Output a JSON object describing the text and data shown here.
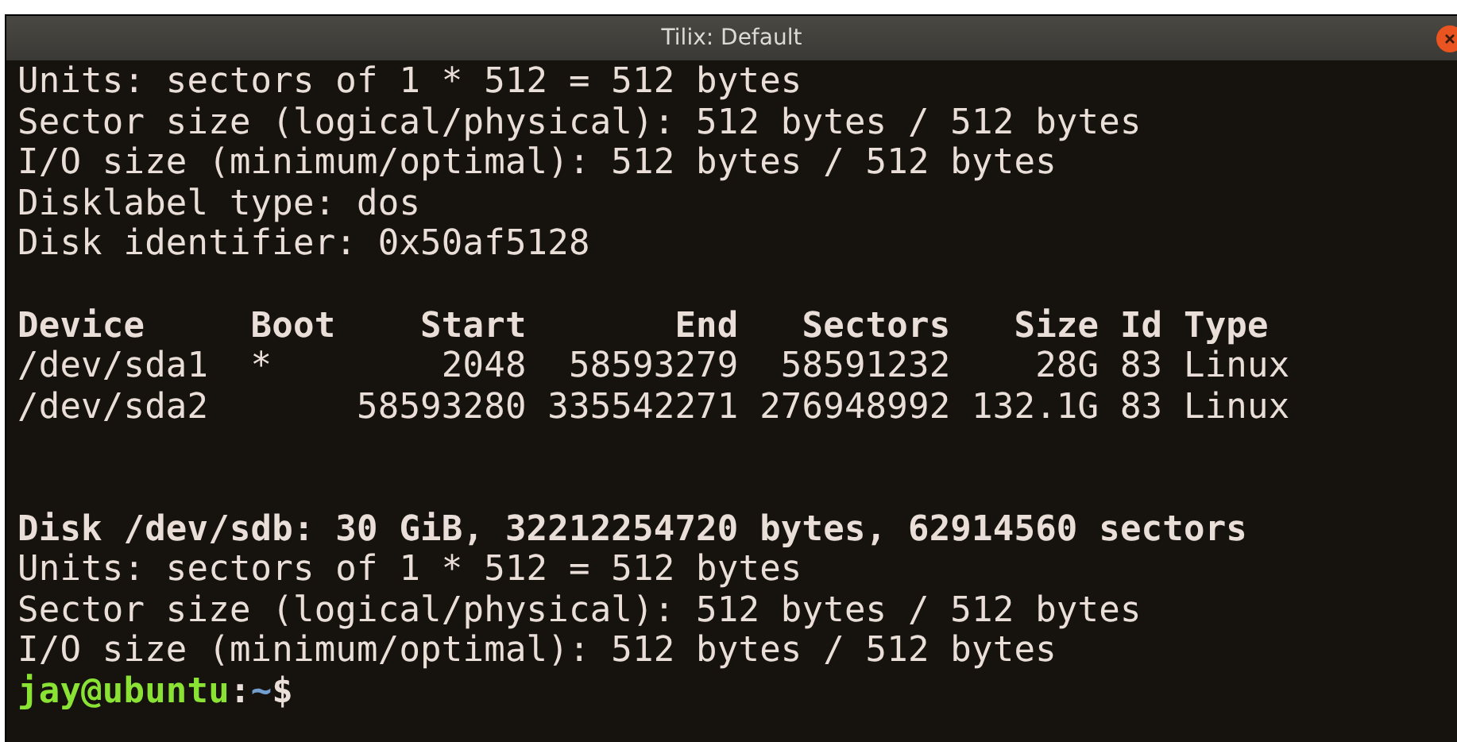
{
  "window": {
    "title": "Tilix: Default"
  },
  "terminal": {
    "lines": [
      {
        "kind": "normal",
        "text": "Units: sectors of 1 * 512 = 512 bytes"
      },
      {
        "kind": "normal",
        "text": "Sector size (logical/physical): 512 bytes / 512 bytes"
      },
      {
        "kind": "normal",
        "text": "I/O size (minimum/optimal): 512 bytes / 512 bytes"
      },
      {
        "kind": "normal",
        "text": "Disklabel type: dos"
      },
      {
        "kind": "normal",
        "text": "Disk identifier: 0x50af5128"
      },
      {
        "kind": "blank"
      },
      {
        "kind": "bold",
        "text": "Device     Boot    Start       End   Sectors   Size Id Type"
      },
      {
        "kind": "normal",
        "text": "/dev/sda1  *        2048  58593279  58591232    28G 83 Linux"
      },
      {
        "kind": "normal",
        "text": "/dev/sda2       58593280 335542271 276948992 132.1G 83 Linux"
      },
      {
        "kind": "blank"
      },
      {
        "kind": "blank"
      },
      {
        "kind": "bold",
        "text": "Disk /dev/sdb: 30 GiB, 32212254720 bytes, 62914560 sectors"
      },
      {
        "kind": "normal",
        "text": "Units: sectors of 1 * 512 = 512 bytes"
      },
      {
        "kind": "normal",
        "text": "Sector size (logical/physical): 512 bytes / 512 bytes"
      },
      {
        "kind": "normal",
        "text": "I/O size (minimum/optimal): 512 bytes / 512 bytes"
      }
    ],
    "prompt": {
      "user_host": "jay@ubuntu",
      "separator": ":",
      "path": "~",
      "symbol": "$"
    }
  }
}
